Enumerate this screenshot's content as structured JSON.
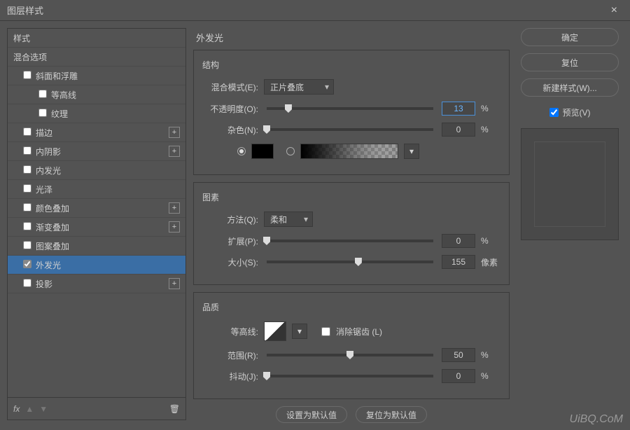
{
  "title": "图层样式",
  "sidebar": {
    "styles": "样式",
    "blendOptions": "混合选项",
    "bevel": "斜面和浮雕",
    "contour": "等高线",
    "texture": "纹理",
    "stroke": "描边",
    "innerShadow": "内阴影",
    "innerGlow": "内发光",
    "satin": "光泽",
    "colorOverlay": "颜色叠加",
    "gradientOverlay": "渐变叠加",
    "patternOverlay": "图案叠加",
    "outerGlow": "外发光",
    "dropShadow": "投影",
    "fx": "fx"
  },
  "panel": {
    "title": "外发光",
    "structure": {
      "title": "结构",
      "blendMode": {
        "label": "混合模式(E):",
        "value": "正片叠底"
      },
      "opacity": {
        "label": "不透明度(O):",
        "value": "13",
        "unit": "%",
        "pos": 13
      },
      "noise": {
        "label": "杂色(N):",
        "value": "0",
        "unit": "%",
        "pos": 0
      }
    },
    "elements": {
      "title": "图素",
      "technique": {
        "label": "方法(Q):",
        "value": "柔和"
      },
      "spread": {
        "label": "扩展(P):",
        "value": "0",
        "unit": "%",
        "pos": 0
      },
      "size": {
        "label": "大小(S):",
        "value": "155",
        "unit": "像素",
        "pos": 55
      }
    },
    "quality": {
      "title": "品质",
      "contourLabel": "等高线:",
      "antiAlias": "消除锯齿 (L)",
      "range": {
        "label": "范围(R):",
        "value": "50",
        "unit": "%",
        "pos": 50
      },
      "jitter": {
        "label": "抖动(J):",
        "value": "0",
        "unit": "%",
        "pos": 0
      }
    },
    "setDefault": "设置为默认值",
    "resetDefault": "复位为默认值"
  },
  "right": {
    "ok": "确定",
    "reset": "复位",
    "newStyle": "新建样式(W)...",
    "preview": "预览(V)"
  },
  "watermark": "UiBQ.CoM"
}
